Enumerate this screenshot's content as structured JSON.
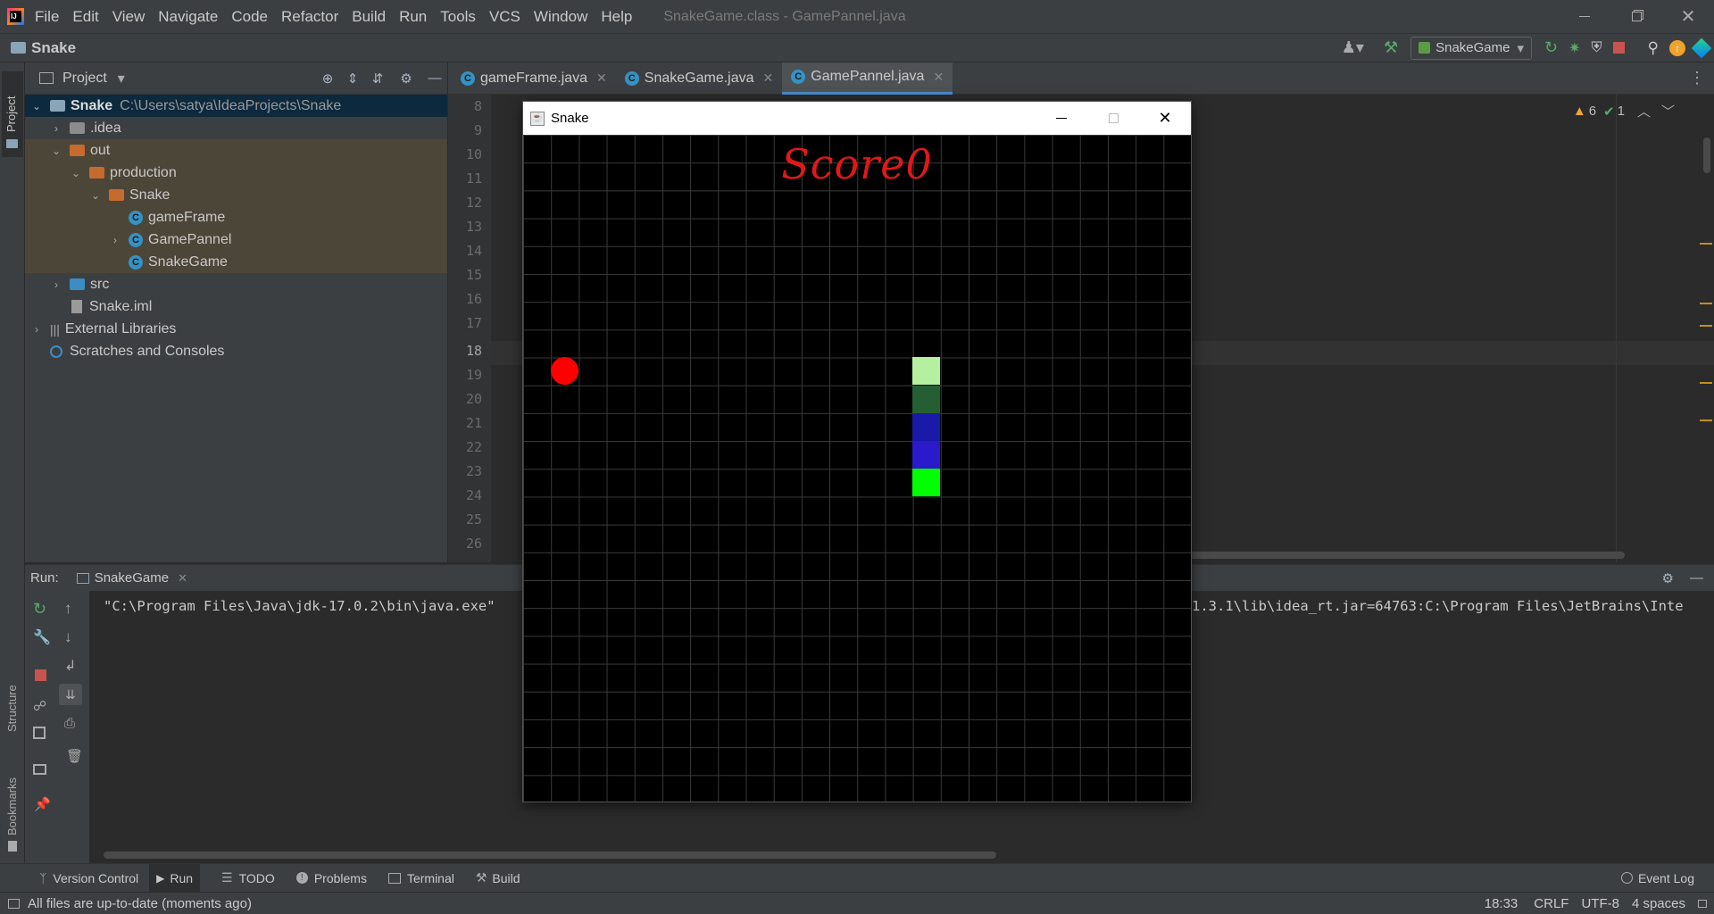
{
  "menu": [
    "File",
    "Edit",
    "View",
    "Navigate",
    "Code",
    "Refactor",
    "Build",
    "Run",
    "Tools",
    "VCS",
    "Window",
    "Help"
  ],
  "window_title": "SnakeGame.class - GamePannel.java",
  "breadcrumb": "Snake",
  "run_config": "SnakeGame",
  "project_panel": {
    "title": "Project",
    "root_name": "Snake",
    "root_path": "C:\\Users\\satya\\IdeaProjects\\Snake",
    "nodes": [
      ".idea",
      "out",
      "production",
      "Snake",
      "gameFrame",
      "GamePannel",
      "SnakeGame",
      "src",
      "Snake.iml",
      "External Libraries",
      "Scratches and Consoles"
    ]
  },
  "editor_tabs": [
    "gameFrame.java",
    "SnakeGame.java",
    "GamePannel.java"
  ],
  "line_numbers": [
    "8",
    "9",
    "10",
    "11",
    "12",
    "13",
    "14",
    "15",
    "16",
    "17",
    "18",
    "19",
    "20",
    "21",
    "22",
    "23",
    "24",
    "25",
    "26"
  ],
  "inspections": {
    "warnings": "6",
    "ok": "1"
  },
  "run_panel": {
    "label": "Run:",
    "tab": "SnakeGame",
    "console_line_left": "\"C:\\Program Files\\Java\\jdk-17.0.2\\bin\\java.exe\"",
    "console_line_right": "1.3.1\\lib\\idea_rt.jar=64763:C:\\Program Files\\JetBrains\\Inte"
  },
  "side_labels": {
    "project": "Project",
    "structure": "Structure",
    "bookmarks": "Bookmarks"
  },
  "bottom_tabs": [
    "Version Control",
    "Run",
    "TODO",
    "Problems",
    "Terminal",
    "Build"
  ],
  "event_log": "Event Log",
  "status": {
    "message": "All files are up-to-date (moments ago)",
    "position": "18:33",
    "line_sep": "CRLF",
    "encoding": "UTF-8",
    "indent": "4 spaces"
  },
  "snake_window": {
    "title": "Snake",
    "score_text": "Score0",
    "grid": {
      "cols": 24,
      "rows": 24
    },
    "apple": {
      "col": 1,
      "row": 8,
      "color": "#ff0000"
    },
    "snake_segments": [
      {
        "col": 14,
        "row": 8,
        "color": "#b4f0a0"
      },
      {
        "col": 14,
        "row": 9,
        "color": "#235f32"
      },
      {
        "col": 14,
        "row": 10,
        "color": "#1a1aa8"
      },
      {
        "col": 14,
        "row": 11,
        "color": "#2a1acc"
      },
      {
        "col": 14,
        "row": 12,
        "color": "#00ff00"
      }
    ]
  },
  "colors": {
    "ide_bg": "#2b2b2b",
    "panel": "#3c3f41",
    "highlight_folder_bg": "#4c4638",
    "selection": "#0d293e",
    "score": "#e01818"
  }
}
